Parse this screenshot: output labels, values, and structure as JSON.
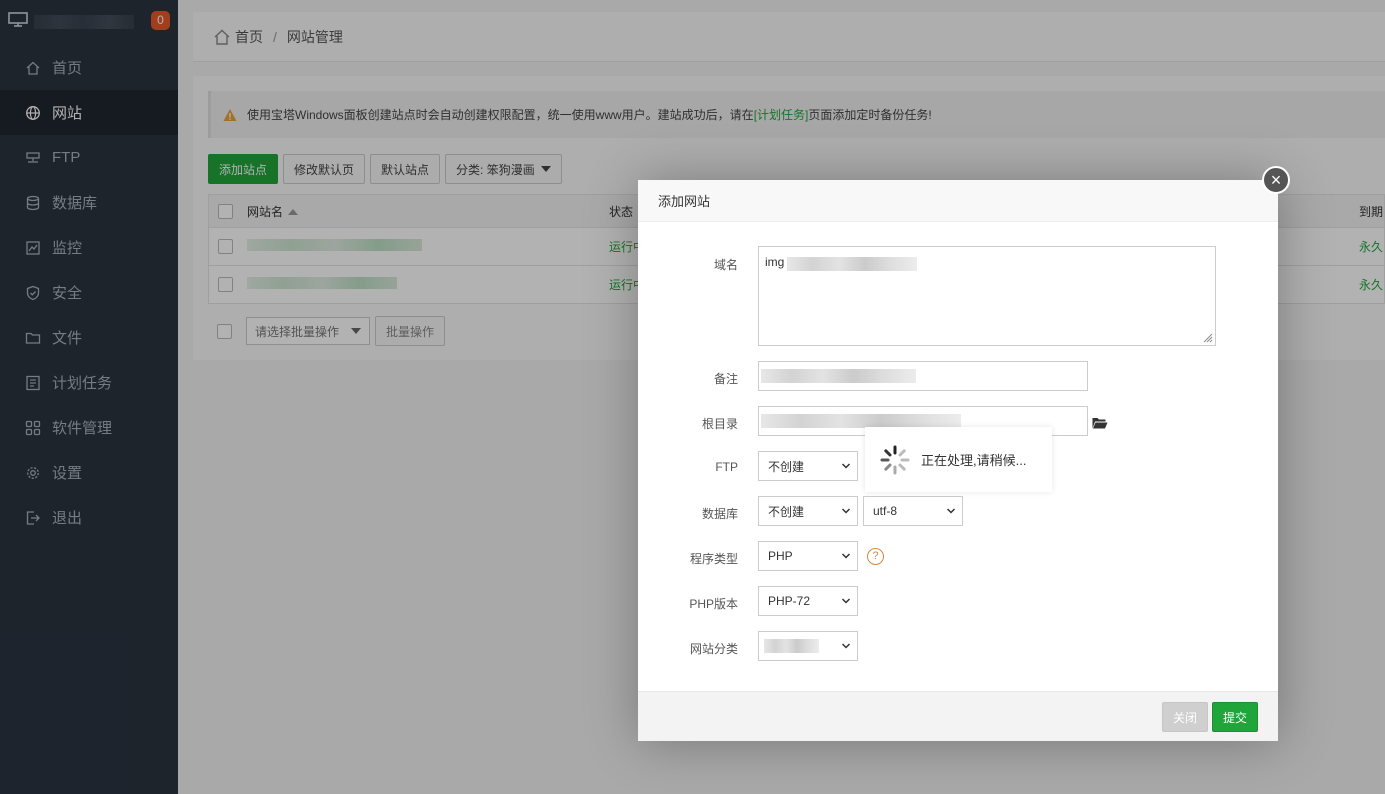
{
  "sidebar": {
    "badge": "0",
    "items": [
      {
        "label": "首页",
        "icon": "home-icon"
      },
      {
        "label": "网站",
        "icon": "globe-icon",
        "active": true
      },
      {
        "label": "FTP",
        "icon": "ftp-icon"
      },
      {
        "label": "数据库",
        "icon": "database-icon"
      },
      {
        "label": "监控",
        "icon": "monitor-icon"
      },
      {
        "label": "安全",
        "icon": "shield-icon"
      },
      {
        "label": "文件",
        "icon": "folder-icon"
      },
      {
        "label": "计划任务",
        "icon": "list-icon"
      },
      {
        "label": "软件管理",
        "icon": "grid-icon"
      },
      {
        "label": "设置",
        "icon": "gear-icon"
      },
      {
        "label": "退出",
        "icon": "logout-icon"
      }
    ]
  },
  "breadcrumb": {
    "home": "首页",
    "sep": "/",
    "current": "网站管理"
  },
  "tip": {
    "before": "使用宝塔Windows面板创建站点时会自动创建权限配置，统一使用www用户。建站成功后，请在",
    "link": "[计划任务]",
    "after": "页面添加定时备份任务!"
  },
  "toolbar": {
    "add_site": "添加站点",
    "modify_default": "修改默认页",
    "default_site": "默认站点",
    "category": "分类: 笨狗漫画"
  },
  "table": {
    "headers": {
      "name": "网站名",
      "status": "状态",
      "expire": "到期"
    },
    "rows": [
      {
        "status": "运行中",
        "expire": "永久"
      },
      {
        "status": "运行中",
        "expire": "永久"
      }
    ]
  },
  "batch": {
    "select_placeholder": "请选择批量操作",
    "button": "批量操作"
  },
  "dialog": {
    "title": "添加网站",
    "close_glyph": "×",
    "labels": {
      "domain": "域名",
      "remark": "备注",
      "root": "根目录",
      "ftp": "FTP",
      "database": "数据库",
      "program": "程序类型",
      "php": "PHP版本",
      "category": "网站分类"
    },
    "domain_value": "img",
    "ftp_value": "不创建",
    "db_value": "不创建",
    "charset_value": "utf-8",
    "program_value": "PHP",
    "php_value": "PHP-72",
    "help_glyph": "?",
    "close_button": "关闭",
    "submit_button": "提交"
  },
  "loading": {
    "text": "正在处理,请稍候..."
  },
  "colors": {
    "accent": "#20a53a",
    "sidebar": "#2b3440",
    "badge": "#e55a2b",
    "help": "#d7873f"
  }
}
